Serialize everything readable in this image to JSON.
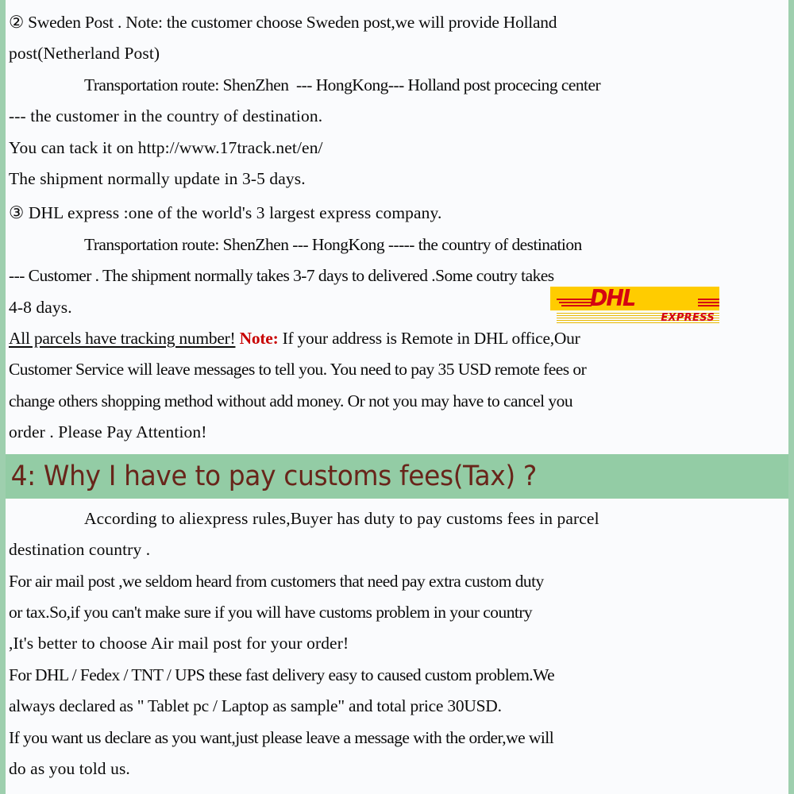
{
  "document": {
    "background_color": "#fafbfd",
    "border_color": "#9ecfae",
    "accent_green": "#93cca5",
    "header_text_color": "#68251a",
    "note_red": "#c80000"
  },
  "sweden_post": {
    "line1": "② Sweden Post . Note: the customer choose Sweden post,we will provide Holland",
    "line2": "post(Netherland Post)",
    "line3": "Transportation route: ShenZhen  --- HongKong--- Holland post procecing center",
    "line4": "--- the customer in the country of destination.",
    "line5": "You can tack it on http://www.17track.net/en/",
    "line6": "The shipment normally update in 3-5 days."
  },
  "dhl_express": {
    "line1": "③ DHL express :one of the world's 3 largest express company.",
    "line2": "Transportation route: ShenZhen --- HongKong ----- the country of destination",
    "line3": "--- Customer . The shipment normally takes 3-7 days to delivered .Some coutry takes",
    "line4": "4-8 days.",
    "tracking_underlined": "All parcels have tracking number!",
    "note_label": "Note:",
    "note_body_1": " If your address is Remote in DHL office,Our",
    "note_body_2": "Customer Service will leave messages to tell you. You need to pay 35 USD remote fees or",
    "note_body_3": "change others shopping method without add money. Or not you may have to cancel you",
    "note_body_4": "order . Please Pay Attention!"
  },
  "dhl_logo": {
    "wordmark": "DHL",
    "subtitle": "EXPRESS",
    "yellow": "#ffcc00",
    "red": "#d40511"
  },
  "section_4": {
    "heading": "4: Why I have to pay customs fees(Tax) ?",
    "line1": "According to aliexpress rules,Buyer has duty to pay customs fees in parcel",
    "line2": "destination country .",
    "line3": "For air mail post ,we seldom heard from customers that need pay extra custom duty",
    "line4": "or tax.So,if you can't make sure if you will have customs problem in your country",
    "line5": ",It's better to choose Air mail post for your order!",
    "line6": "For DHL / Fedex / TNT / UPS these fast delivery easy to caused custom problem.We",
    "line7": "always declared as \" Tablet pc / Laptop as sample\" and total price 30USD.",
    "line8": "If you want us declare as you want,just please leave a message with the order,we will",
    "line9": "do as you told us."
  }
}
